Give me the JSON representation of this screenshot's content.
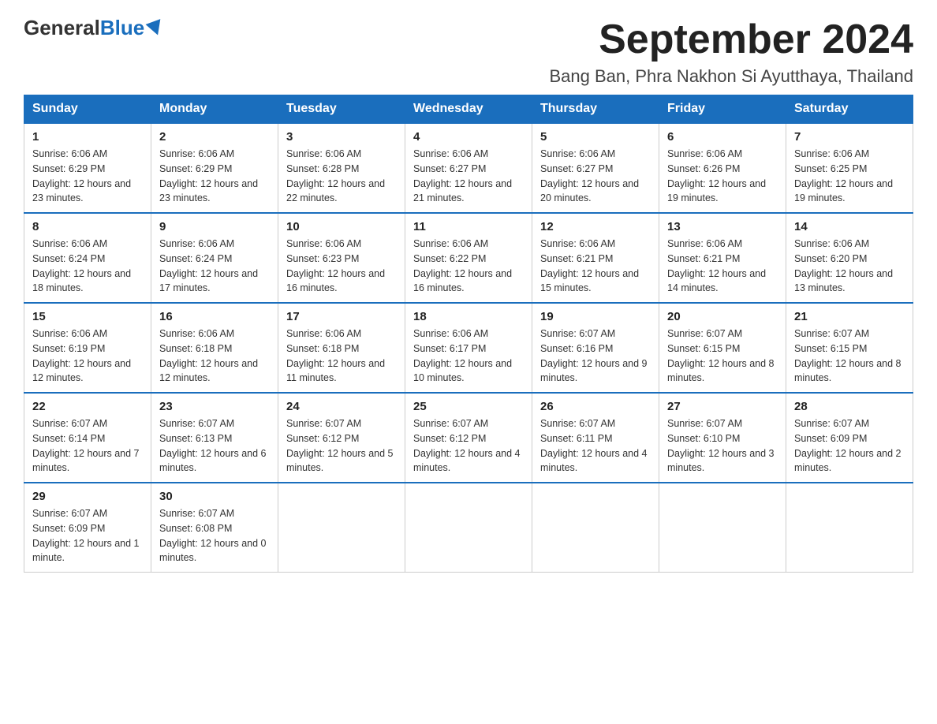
{
  "logo": {
    "general": "General",
    "blue": "Blue"
  },
  "header": {
    "month_year": "September 2024",
    "location": "Bang Ban, Phra Nakhon Si Ayutthaya, Thailand"
  },
  "days_of_week": [
    "Sunday",
    "Monday",
    "Tuesday",
    "Wednesday",
    "Thursday",
    "Friday",
    "Saturday"
  ],
  "weeks": [
    [
      {
        "day": "1",
        "sunrise": "6:06 AM",
        "sunset": "6:29 PM",
        "daylight": "12 hours and 23 minutes."
      },
      {
        "day": "2",
        "sunrise": "6:06 AM",
        "sunset": "6:29 PM",
        "daylight": "12 hours and 23 minutes."
      },
      {
        "day": "3",
        "sunrise": "6:06 AM",
        "sunset": "6:28 PM",
        "daylight": "12 hours and 22 minutes."
      },
      {
        "day": "4",
        "sunrise": "6:06 AM",
        "sunset": "6:27 PM",
        "daylight": "12 hours and 21 minutes."
      },
      {
        "day": "5",
        "sunrise": "6:06 AM",
        "sunset": "6:27 PM",
        "daylight": "12 hours and 20 minutes."
      },
      {
        "day": "6",
        "sunrise": "6:06 AM",
        "sunset": "6:26 PM",
        "daylight": "12 hours and 19 minutes."
      },
      {
        "day": "7",
        "sunrise": "6:06 AM",
        "sunset": "6:25 PM",
        "daylight": "12 hours and 19 minutes."
      }
    ],
    [
      {
        "day": "8",
        "sunrise": "6:06 AM",
        "sunset": "6:24 PM",
        "daylight": "12 hours and 18 minutes."
      },
      {
        "day": "9",
        "sunrise": "6:06 AM",
        "sunset": "6:24 PM",
        "daylight": "12 hours and 17 minutes."
      },
      {
        "day": "10",
        "sunrise": "6:06 AM",
        "sunset": "6:23 PM",
        "daylight": "12 hours and 16 minutes."
      },
      {
        "day": "11",
        "sunrise": "6:06 AM",
        "sunset": "6:22 PM",
        "daylight": "12 hours and 16 minutes."
      },
      {
        "day": "12",
        "sunrise": "6:06 AM",
        "sunset": "6:21 PM",
        "daylight": "12 hours and 15 minutes."
      },
      {
        "day": "13",
        "sunrise": "6:06 AM",
        "sunset": "6:21 PM",
        "daylight": "12 hours and 14 minutes."
      },
      {
        "day": "14",
        "sunrise": "6:06 AM",
        "sunset": "6:20 PM",
        "daylight": "12 hours and 13 minutes."
      }
    ],
    [
      {
        "day": "15",
        "sunrise": "6:06 AM",
        "sunset": "6:19 PM",
        "daylight": "12 hours and 12 minutes."
      },
      {
        "day": "16",
        "sunrise": "6:06 AM",
        "sunset": "6:18 PM",
        "daylight": "12 hours and 12 minutes."
      },
      {
        "day": "17",
        "sunrise": "6:06 AM",
        "sunset": "6:18 PM",
        "daylight": "12 hours and 11 minutes."
      },
      {
        "day": "18",
        "sunrise": "6:06 AM",
        "sunset": "6:17 PM",
        "daylight": "12 hours and 10 minutes."
      },
      {
        "day": "19",
        "sunrise": "6:07 AM",
        "sunset": "6:16 PM",
        "daylight": "12 hours and 9 minutes."
      },
      {
        "day": "20",
        "sunrise": "6:07 AM",
        "sunset": "6:15 PM",
        "daylight": "12 hours and 8 minutes."
      },
      {
        "day": "21",
        "sunrise": "6:07 AM",
        "sunset": "6:15 PM",
        "daylight": "12 hours and 8 minutes."
      }
    ],
    [
      {
        "day": "22",
        "sunrise": "6:07 AM",
        "sunset": "6:14 PM",
        "daylight": "12 hours and 7 minutes."
      },
      {
        "day": "23",
        "sunrise": "6:07 AM",
        "sunset": "6:13 PM",
        "daylight": "12 hours and 6 minutes."
      },
      {
        "day": "24",
        "sunrise": "6:07 AM",
        "sunset": "6:12 PM",
        "daylight": "12 hours and 5 minutes."
      },
      {
        "day": "25",
        "sunrise": "6:07 AM",
        "sunset": "6:12 PM",
        "daylight": "12 hours and 4 minutes."
      },
      {
        "day": "26",
        "sunrise": "6:07 AM",
        "sunset": "6:11 PM",
        "daylight": "12 hours and 4 minutes."
      },
      {
        "day": "27",
        "sunrise": "6:07 AM",
        "sunset": "6:10 PM",
        "daylight": "12 hours and 3 minutes."
      },
      {
        "day": "28",
        "sunrise": "6:07 AM",
        "sunset": "6:09 PM",
        "daylight": "12 hours and 2 minutes."
      }
    ],
    [
      {
        "day": "29",
        "sunrise": "6:07 AM",
        "sunset": "6:09 PM",
        "daylight": "12 hours and 1 minute."
      },
      {
        "day": "30",
        "sunrise": "6:07 AM",
        "sunset": "6:08 PM",
        "daylight": "12 hours and 0 minutes."
      },
      null,
      null,
      null,
      null,
      null
    ]
  ]
}
